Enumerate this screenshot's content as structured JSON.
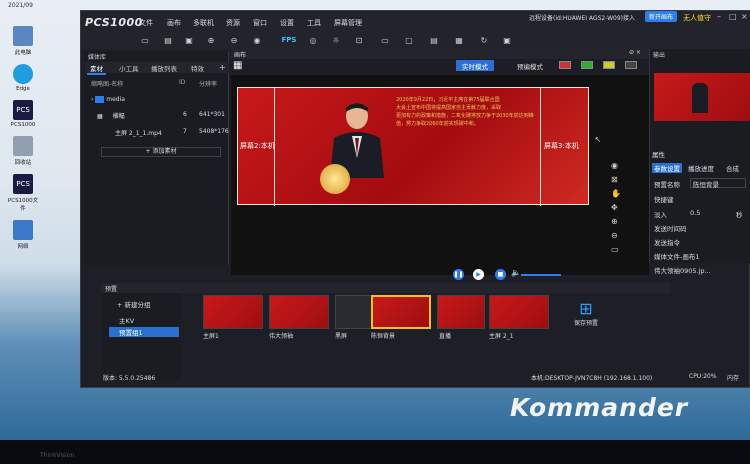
{
  "desktop": {
    "clock_top": "2021/09",
    "icons": [
      "此电脑",
      "Edge",
      "PCS1000",
      "回收站",
      "PCS1000文件",
      "网络"
    ],
    "system": "ThinkVision"
  },
  "app": {
    "logo": "PCS1000",
    "menus": [
      "文件",
      "画布",
      "多联机",
      "资源",
      "窗口",
      "设置",
      "工具",
      "屏幕管理"
    ],
    "remote_device": "远程设备(id:HUAWEI AGS2-W09)接入",
    "new_version_button": "新开画布",
    "no_guard": "无人值守",
    "fps": "FPS"
  },
  "media_library": {
    "title": "媒体库",
    "tabs": [
      "素材",
      "小工具",
      "播放列表",
      "特效"
    ],
    "columns": [
      "缩略图-名称",
      "ID",
      "分辨率"
    ],
    "items": [
      {
        "name": "media",
        "id": "",
        "res": ""
      },
      {
        "name": "横幅",
        "id": "6",
        "res": "641*301"
      },
      {
        "name": "主屏 2_1_1.mp4",
        "id": "7",
        "res": "5408*176"
      }
    ],
    "add_button": "+ 添加素材"
  },
  "canvas": {
    "title": "画布",
    "modes": [
      "实时模式",
      "预编模式"
    ],
    "active_mode": "实时模式",
    "screen_left_label": "屏幕2:本机",
    "screen_right_label": "屏幕3:本机",
    "banner_text_1": "2020年9月22日，习近平主席在第75届联合国",
    "banner_text_2": "大会上宣布中国将提高国家自主贡献力度，采取",
    "banner_text_3": "更加有力的政策和措施，二氧化碳排放力争于2030年前达到峰值，努力争取2060年前实现碳中和。"
  },
  "output_panel": {
    "title": "输出",
    "props_title": "属性",
    "tabs": [
      "参数设置",
      "播放进度",
      "合成"
    ],
    "preset_name_label": "预置名称",
    "preset_name_value": "陈恒背景",
    "shortcut": "快捷键",
    "fade_label": "淡入",
    "fade_value": "0.5",
    "fade_unit": "秒",
    "send_time": "发送时间码",
    "send_command": "发送指令",
    "media_file": "媒体文件-画布1",
    "media_item": "伟大领袖0905.jp..."
  },
  "preset": {
    "title": "预置",
    "new_group": "+ 新建分组",
    "groups": [
      "主KV",
      "预置组1"
    ],
    "thumbs": [
      {
        "label": "主屏1"
      },
      {
        "label": "伟大领袖"
      },
      {
        "label": "黑屏"
      },
      {
        "label": "陈恒背景"
      },
      {
        "label": "直播"
      },
      {
        "label": "主屏 2_1"
      }
    ],
    "save_preset": "保存预置"
  },
  "statusbar": {
    "version": "版本: 5.5.0.25486",
    "host": "本机:DESKTOP-JVN7C8H (192.168.1.100)",
    "cpu": "CPU:20%",
    "mem": "内存"
  },
  "watermark": "Kommander"
}
